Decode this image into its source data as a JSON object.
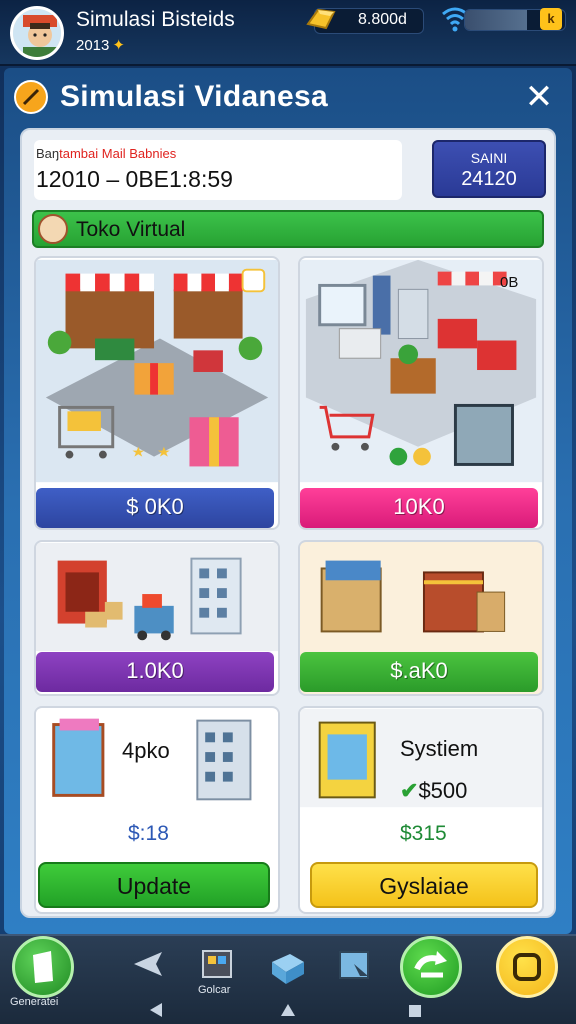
{
  "header": {
    "player_name": "Simulasi Bisteids",
    "player_level": "2013",
    "coins": "8.800d",
    "energy_badge": "k",
    "energy_fraction": 0.62
  },
  "panel": {
    "title": "Simulasi Vidanesa",
    "close_label": "✕"
  },
  "info": {
    "label_prefix": "Baŋ",
    "label_red": "tambai Mail Babnies",
    "datetime": "12010 – 0BE1:8:59",
    "date_box_line1": "SAINI",
    "date_box_line2": "24120"
  },
  "section": {
    "title": "Toko Virtual"
  },
  "cards": {
    "top_left_price": "$ 0K0",
    "top_right_price": "10K0",
    "top_right_badge": "0B",
    "mid_left_price": "1.0K0",
    "mid_right_price": "$.aK0",
    "bottom_left_label": "4pko",
    "bottom_left_price": "$:18",
    "bottom_right_label": "Systiem",
    "bottom_right_sub": "$500",
    "bottom_right_price": "$315",
    "update_button": "Update",
    "secondary_button": "Gyslaiae"
  },
  "nav": {
    "left_label": "Generatei",
    "mid_label": "Golcar"
  }
}
